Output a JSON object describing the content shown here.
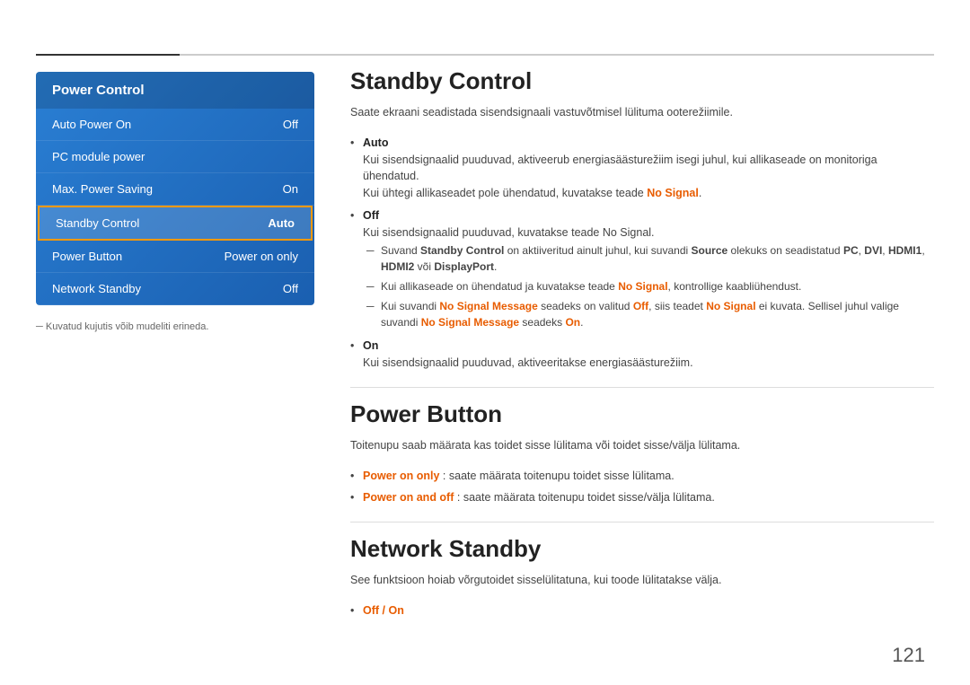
{
  "topline": {},
  "leftPanel": {
    "title": "Power Control",
    "items": [
      {
        "label": "Auto Power On",
        "value": "Off",
        "active": false
      },
      {
        "label": "PC module power",
        "value": "",
        "active": false
      },
      {
        "label": "Max. Power Saving",
        "value": "On",
        "active": false
      },
      {
        "label": "Standby Control",
        "value": "Auto",
        "active": true
      },
      {
        "label": "Power Button",
        "value": "Power on only",
        "active": false
      },
      {
        "label": "Network Standby",
        "value": "Off",
        "active": false
      }
    ],
    "footnote": "Kuvatud kujutis võib mudeliti erineda."
  },
  "sections": [
    {
      "id": "standby-control",
      "title": "Standby Control",
      "intro": "Saate ekraani seadistada sisendsignaali vastuvõtmisel lülituma ooterežiimile.",
      "bullets": [
        {
          "label": "Auto",
          "desc": "Kui sisendsignaalid puuduvad, aktiveerub energiasäästurežiim isegi juhul, kui allikaseade on monitoriga ühendatud.",
          "subdesc": "Kui ühtegi allikaseadet pole ühendatud, kuvatakse teade No Signal.",
          "subOrange": "No Signal"
        },
        {
          "label": "Off",
          "desc": "Kui sisendsignaalid puuduvad, kuvatakse teade No Signal.",
          "subOrange": "No Signal",
          "dashes": [
            "Suvand Standby Control on aktiiveritud ainult juhul, kui suvandi Source olekuks on seadistatud PC, DVI, HDMI1, HDMI2 või DisplayPort.",
            "Kui allikaseade on ühendatud ja kuvatakse teade No Signal, kontrollige kaabliühendust.",
            "Kui suvandi No Signal Message seadeks on valitud Off, siis teadet No Signal ei kuvata. Sellisel juhul valige suvandi No Signal Message seadeks On."
          ]
        },
        {
          "label": "On",
          "desc": "Kui sisendsignaalid puuduvad, aktiveeritakse energiasäästurežiim."
        }
      ]
    },
    {
      "id": "power-button",
      "title": "Power Button",
      "intro": "Toitenupu saab määrata kas toidet sisse lülitama või toidet sisse/välja lülitama.",
      "bullets": [
        {
          "label": "Power on only",
          "labelSuffix": ": saate määrata toitenupu toidet sisse lülitama."
        },
        {
          "label": "Power on and off",
          "labelSuffix": ": saate määrata toitenupu toidet sisse/välja lülitama."
        }
      ]
    },
    {
      "id": "network-standby",
      "title": "Network Standby",
      "intro": "See funktsioon hoiab võrgutoidet sisselülitatuna, kui toode lülitatakse välja.",
      "bullets": [
        {
          "label": "Off / On",
          "isOrange": true
        }
      ]
    }
  ],
  "pageNumber": "121"
}
